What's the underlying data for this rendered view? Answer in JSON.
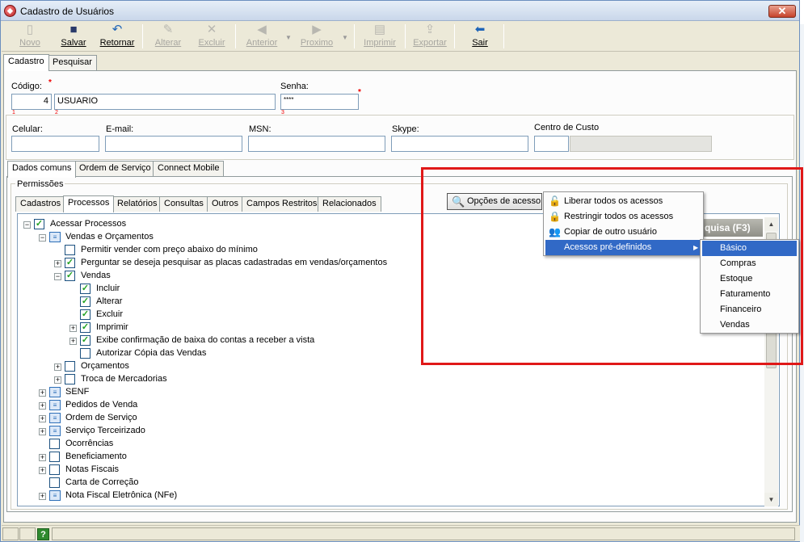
{
  "window": {
    "title": "Cadastro de Usuários",
    "close": "✕"
  },
  "toolbar": {
    "buttons": [
      {
        "label": "Novo",
        "icon": "new-document-icon",
        "glyph": "▯"
      },
      {
        "label": "Salvar",
        "icon": "save-disk-icon",
        "glyph": "■"
      },
      {
        "label": "Retornar",
        "icon": "undo-arrow-icon",
        "glyph": "↶"
      },
      {
        "label": "Alterar",
        "icon": "edit-icon",
        "glyph": "✎"
      },
      {
        "label": "Excluir",
        "icon": "delete-x-icon",
        "glyph": "✕"
      },
      {
        "label": "Anterior",
        "icon": "arrow-left-icon",
        "glyph": "◀"
      },
      {
        "label": "Proximo",
        "icon": "arrow-right-icon",
        "glyph": "▶"
      },
      {
        "label": "Imprimir",
        "icon": "printer-icon",
        "glyph": "▤"
      },
      {
        "label": "Exportar",
        "icon": "export-icon",
        "glyph": "⇪"
      },
      {
        "label": "Sair",
        "icon": "exit-arrow-icon",
        "glyph": "⬅"
      }
    ]
  },
  "tabs_top": [
    "Cadastro",
    "Pesquisar"
  ],
  "form": {
    "codigo_label": "Código:",
    "codigo_value": "4",
    "nome_value": "USUARIO",
    "senha_label": "Senha:",
    "senha_value": "****",
    "celular_label": "Celular:",
    "email_label": "E-mail:",
    "msn_label": "MSN:",
    "skype_label": "Skype:",
    "centro_label": "Centro de Custo",
    "req_mark": "*",
    "order_1": "1",
    "order_2": "2",
    "order_3": "3"
  },
  "tabs_mid": [
    "Dados comuns",
    "Ordem de Serviço",
    "Connect Mobile"
  ],
  "permissoes": {
    "title": "Permissões",
    "tabs": [
      "Cadastros",
      "Processos",
      "Relatórios",
      "Consultas",
      "Outros",
      "Campos Restritos",
      "Relacionados"
    ],
    "opcoes_button": "Opções de acesso",
    "pesquisa_button": "quisa (F3)"
  },
  "tree": [
    {
      "label": "Acessar Processos",
      "level": 0,
      "expand": "−",
      "check": true,
      "type": "cb"
    },
    {
      "label": "Vendas e Orçamentos",
      "level": 1,
      "expand": "−",
      "check": false,
      "type": "tri"
    },
    {
      "label": "Permitir vender com preço abaixo do mínimo",
      "level": 2,
      "expand": "",
      "check": false,
      "type": "cb"
    },
    {
      "label": "Perguntar se deseja pesquisar as placas cadastradas em vendas/orçamentos",
      "level": 2,
      "expand": "+",
      "check": true,
      "type": "cb"
    },
    {
      "label": "Vendas",
      "level": 2,
      "expand": "−",
      "check": true,
      "type": "cb"
    },
    {
      "label": "Incluir",
      "level": 3,
      "expand": "",
      "check": true,
      "type": "cb"
    },
    {
      "label": "Alterar",
      "level": 3,
      "expand": "",
      "check": true,
      "type": "cb"
    },
    {
      "label": "Excluir",
      "level": 3,
      "expand": "",
      "check": true,
      "type": "cb"
    },
    {
      "label": "Imprimir",
      "level": 3,
      "expand": "+",
      "check": true,
      "type": "cb"
    },
    {
      "label": "Exibe confirmação de baixa do contas a receber a vista",
      "level": 3,
      "expand": "+",
      "check": true,
      "type": "cb"
    },
    {
      "label": "Autorizar Cópia das Vendas",
      "level": 3,
      "expand": "",
      "check": false,
      "type": "cb"
    },
    {
      "label": "Orçamentos",
      "level": 2,
      "expand": "+",
      "check": false,
      "type": "cb"
    },
    {
      "label": "Troca de Mercadorias",
      "level": 2,
      "expand": "+",
      "check": false,
      "type": "cb"
    },
    {
      "label": "SENF",
      "level": 1,
      "expand": "+",
      "check": false,
      "type": "tri"
    },
    {
      "label": "Pedidos de Venda",
      "level": 1,
      "expand": "+",
      "check": false,
      "type": "tri"
    },
    {
      "label": "Ordem de Serviço",
      "level": 1,
      "expand": "+",
      "check": false,
      "type": "tri"
    },
    {
      "label": "Serviço Terceirizado",
      "level": 1,
      "expand": "+",
      "check": false,
      "type": "tri"
    },
    {
      "label": "Ocorrências",
      "level": 1,
      "expand": "",
      "check": false,
      "type": "cb"
    },
    {
      "label": "Beneficiamento",
      "level": 1,
      "expand": "+",
      "check": false,
      "type": "cb"
    },
    {
      "label": "Notas Fiscais",
      "level": 1,
      "expand": "+",
      "check": false,
      "type": "cb"
    },
    {
      "label": "Carta de Correção",
      "level": 1,
      "expand": "",
      "check": false,
      "type": "cb"
    },
    {
      "label": "Nota Fiscal Eletrônica (NFe)",
      "level": 1,
      "expand": "+",
      "check": false,
      "type": "tri"
    }
  ],
  "context_menu": {
    "items": [
      {
        "label": "Liberar todos os acessos",
        "icon": "unlock-icon"
      },
      {
        "label": "Restringir todos os acessos",
        "icon": "lock-icon"
      },
      {
        "label": "Copiar de outro usuário",
        "icon": "users-icon"
      },
      {
        "label": "Acessos pré-definidos",
        "icon": "submenu-arrow-icon"
      }
    ]
  },
  "submenu": {
    "items": [
      "Básico",
      "Compras",
      "Estoque",
      "Faturamento",
      "Financeiro",
      "Vendas"
    ]
  },
  "status": {
    "help": "?"
  },
  "colors": {
    "highlight": "#3169c6",
    "annotation": "#e01818",
    "check": "#21a121"
  }
}
